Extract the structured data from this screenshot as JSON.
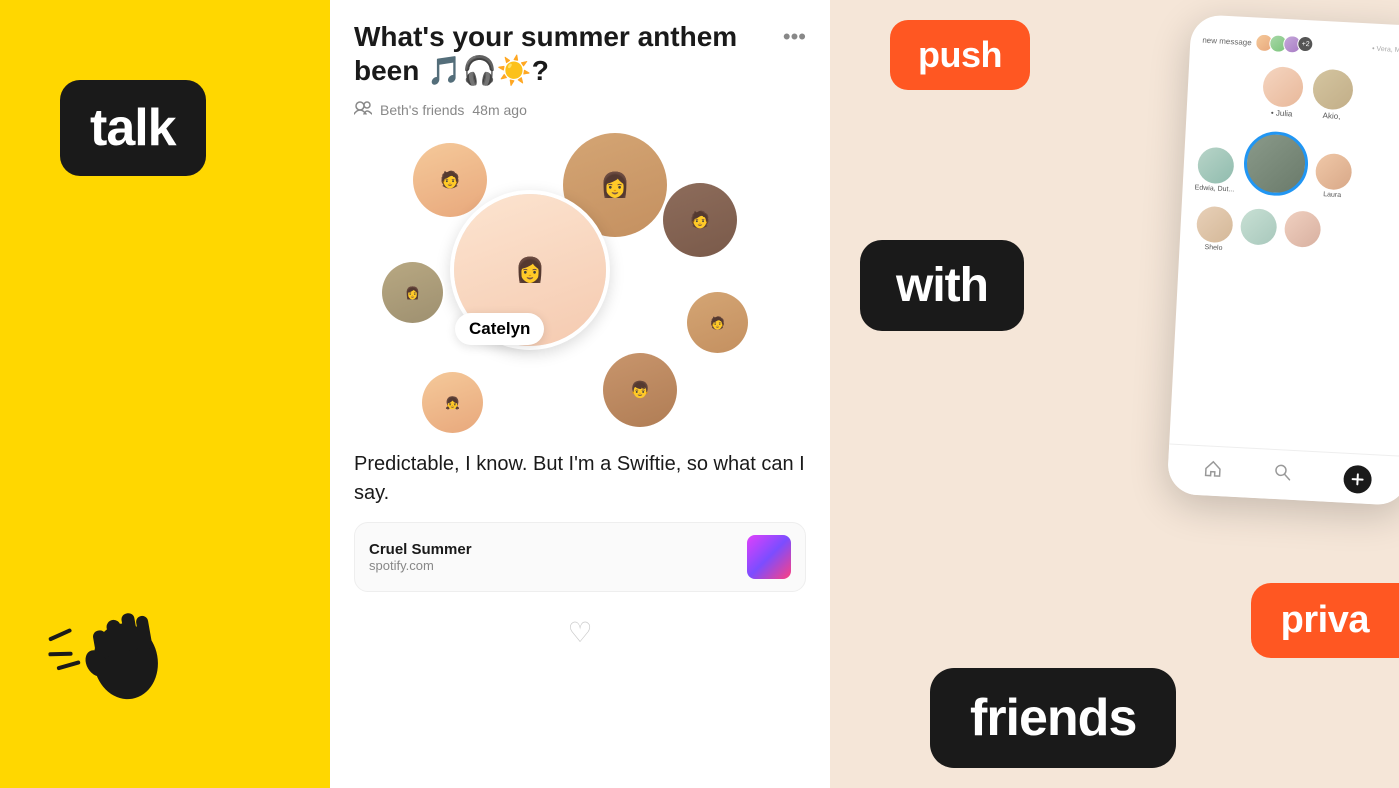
{
  "left": {
    "app_name": "talk",
    "wave_emoji": "👋"
  },
  "post": {
    "title": "What's your summer anthem been 🎵🎧☀️?",
    "more_label": "•••",
    "author": "Beth's friends",
    "time_ago": "48m ago",
    "catelyn_label": "Catelyn",
    "post_text": "Predictable, I know. But I'm a Swiftie, so what can I say.",
    "track_name": "Cruel Summer",
    "track_url": "spotify.com",
    "heart_icon": "♡"
  },
  "right": {
    "push_label": "push",
    "with_label": "with",
    "friends_label": "friends",
    "priva_label": "priva",
    "phone": {
      "notification": "new message",
      "people": [
        {
          "name": "Julia"
        },
        {
          "name": "Akio"
        },
        {
          "name": "Edwia, Dut..."
        },
        {
          "name": "Shelo"
        },
        {
          "name": ""
        },
        {
          "name": "Laura"
        }
      ]
    }
  }
}
